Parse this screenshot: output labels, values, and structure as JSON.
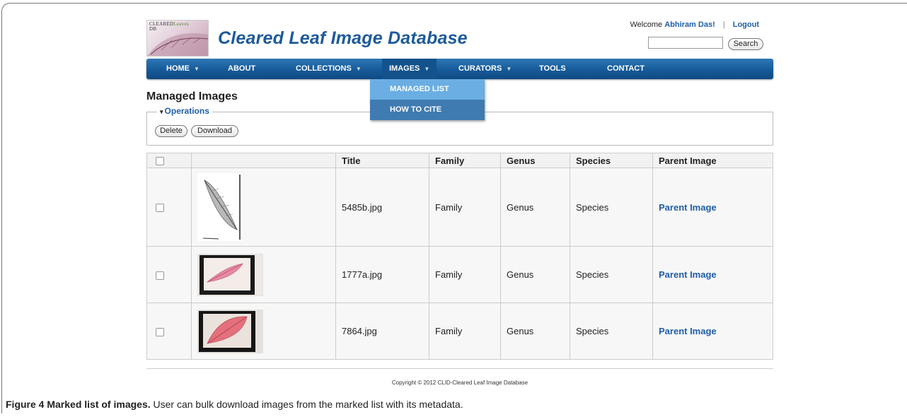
{
  "app": {
    "logo_text_top": "CLEARED",
    "logo_text_green": "Leaves",
    "logo_text_bottom": "DB",
    "site_title": "Cleared Leaf Image Database"
  },
  "header": {
    "welcome_label": "Welcome",
    "user_name": "Abhiram Das!",
    "separator": "|",
    "logout_label": "Logout",
    "search_value": "",
    "search_button": "Search"
  },
  "nav": {
    "items": [
      {
        "label": "HOME",
        "caret": "▼"
      },
      {
        "label": "ABOUT",
        "caret": ""
      },
      {
        "label": "COLLECTIONS",
        "caret": "▼"
      },
      {
        "label": "IMAGES",
        "caret": "▼"
      },
      {
        "label": "CURATORS",
        "caret": "▼"
      },
      {
        "label": "TOOLS",
        "caret": ""
      },
      {
        "label": "CONTACT",
        "caret": ""
      }
    ],
    "dropdown": [
      {
        "label": "MANAGED LIST"
      },
      {
        "label": "HOW TO CITE"
      }
    ]
  },
  "main": {
    "heading": "Managed Images",
    "operations_label": "Operations",
    "operations_toggle": "▾",
    "delete_label": "Delete",
    "download_label": "Download"
  },
  "table": {
    "headers": [
      "",
      "",
      "Title",
      "Family",
      "Genus",
      "Species",
      "Parent Image"
    ],
    "rows": [
      {
        "title": "5485b.jpg",
        "family": "Family",
        "genus": "Genus",
        "species": "Species",
        "parent": "Parent Image"
      },
      {
        "title": "1777a.jpg",
        "family": "Family",
        "genus": "Genus",
        "species": "Species",
        "parent": "Parent Image"
      },
      {
        "title": "7864.jpg",
        "family": "Family",
        "genus": "Genus",
        "species": "Species",
        "parent": "Parent Image"
      }
    ]
  },
  "footer": {
    "copyright": "Copyright © 2012 CLID-Cleared Leaf Image Database"
  },
  "caption": {
    "title": "Figure 4 Marked list of images.",
    "text": " User can bulk download images from the marked list with its metadata."
  },
  "colors": {
    "link_blue": "#1f5ea8",
    "nav_blue": "#165a98",
    "dropdown_blue": "#4f8fc7"
  }
}
